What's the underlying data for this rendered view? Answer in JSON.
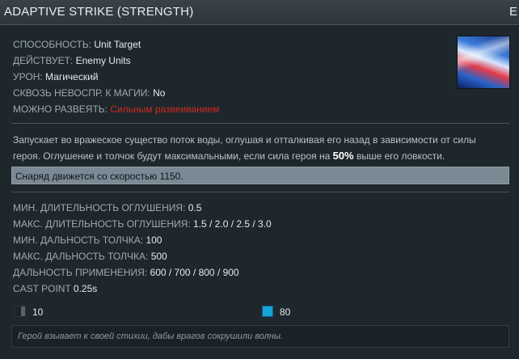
{
  "header": {
    "title": "ADAPTIVE STRIKE (STRENGTH)",
    "title_tail": "E"
  },
  "properties": [
    {
      "label": "СПОСОБНОСТЬ:",
      "value": "Unit Target"
    },
    {
      "label": "ДЕЙСТВУЕТ:",
      "value": "Enemy Units"
    },
    {
      "label": "УРОН:",
      "value": "Магический"
    },
    {
      "label": "СКВОЗЬ НЕВОСПР. К МАГИИ:",
      "value": "No"
    },
    {
      "label": "МОЖНО РАЗВЕЯТЬ:",
      "value": "Сильным развеиванием",
      "value_color": "#d22a1f"
    }
  ],
  "ability_icon": "adaptive-strike-ability-icon",
  "description": {
    "text_before": "Запускает во вражеское существо поток воды, оглушая и отталкивая его назад в зависимости от силы героя. Оглушение и толчок будут максимальными, если сила героя на ",
    "highlight": "50%",
    "text_after": " выше его ловкости."
  },
  "note": "Снаряд движется со скоростью 1150.",
  "stats": [
    {
      "label": "МИН. ДЛИТЕЛЬНОСТЬ ОГЛУШЕНИЯ:",
      "value": "0.5"
    },
    {
      "label": "МАКС. ДЛИТЕЛЬНОСТЬ ОГЛУШЕНИЯ:",
      "value": "1.5 / 2.0 / 2.5 / 3.0"
    },
    {
      "label": "МИН. ДАЛЬНОСТЬ ТОЛЧКА:",
      "value": "100"
    },
    {
      "label": "МАКС. ДАЛЬНОСТЬ ТОЛЧКА:",
      "value": "500"
    },
    {
      "label": "ДАЛЬНОСТЬ ПРИМЕНЕНИЯ:",
      "value": "600 / 700 / 800 / 900"
    },
    {
      "label": "CAST POINT",
      "value": "0.25s"
    }
  ],
  "costs": {
    "cooldown": {
      "icon": "cooldown-icon",
      "value": "10"
    },
    "mana": {
      "icon": "mana-icon",
      "value": "80",
      "color": "#16a4d8"
    }
  },
  "lore": "Герой взывает к своей стихии, дабы врагов сокрушили волны."
}
